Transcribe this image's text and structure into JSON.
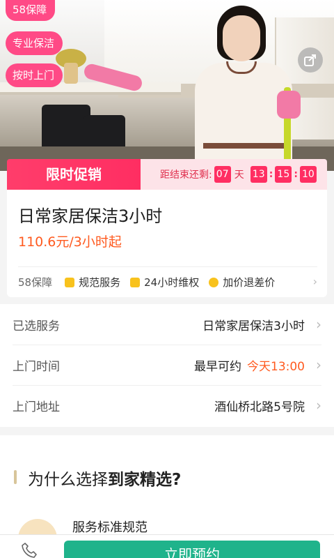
{
  "hero": {
    "tags": [
      "58保障",
      "专业保洁",
      "按时上门"
    ]
  },
  "promo": {
    "label": "限时促销",
    "countdown_label": "距结束还剩:",
    "days": "07",
    "day_unit": "天",
    "hours": "13",
    "minutes": "15",
    "seconds": "10"
  },
  "service": {
    "title": "日常家居保洁3小时",
    "price": "110.6元/3小时起",
    "guarantee_main": "58保障",
    "guarantees": [
      "规范服务",
      "24小时维权",
      "加价退差价"
    ]
  },
  "options": [
    {
      "label": "已选服务",
      "value": "日常家居保洁3小时"
    },
    {
      "label": "上门时间",
      "value": "最早可约",
      "highlight": "今天13:00"
    },
    {
      "label": "上门地址",
      "value": "酒仙桥北路5号院"
    }
  ],
  "why": {
    "heading_prefix": "为什么选择",
    "heading_bold": "到家精选?",
    "feature_title": "服务标准规范"
  },
  "bottom": {
    "book_label": "立即预约"
  },
  "colors": {
    "accent_pink": "#ff3d6b",
    "price_orange": "#ff5a1f",
    "book_green": "#1fb38b"
  }
}
